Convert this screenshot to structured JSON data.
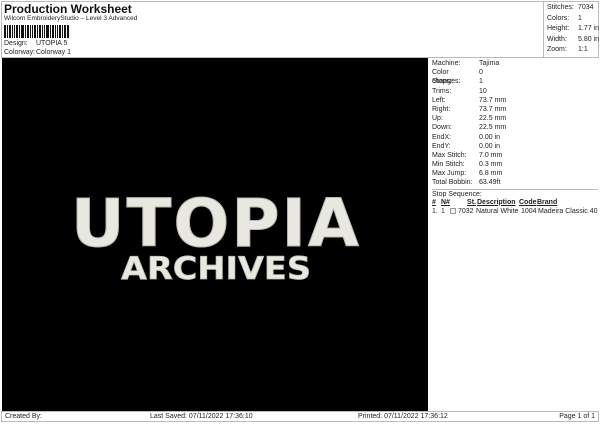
{
  "header": {
    "title": "Production Worksheet",
    "subtitle": "Wilcom EmbroideryStudio – Level 3 Advanced",
    "design_label": "Design:",
    "design_value": "UTOPIA 5",
    "colorway_label": "Colorway:",
    "colorway_value": "Colorway 1"
  },
  "stats": [
    {
      "label": "Stitches:",
      "value": "7034"
    },
    {
      "label": "Colors:",
      "value": "1"
    },
    {
      "label": "Height:",
      "value": "1.77 in"
    },
    {
      "label": "Width:",
      "value": "5.80 in"
    },
    {
      "label": "Zoom:",
      "value": "1:1"
    }
  ],
  "design": {
    "line1": "UTOPIA",
    "line2": "ARCHIVES",
    "thread_color": "#e8e8e0",
    "background": "#000000"
  },
  "info": [
    {
      "label": "Machine:",
      "value": "Tajima"
    },
    {
      "label": "Color changes:",
      "value": "0"
    },
    {
      "label": "Stops:",
      "value": "1"
    },
    {
      "label": "Trims:",
      "value": "10"
    },
    {
      "label": "Left:",
      "value": "73.7 mm"
    },
    {
      "label": "Right:",
      "value": "73.7 mm"
    },
    {
      "label": "Up:",
      "value": "22.5 mm"
    },
    {
      "label": "Down:",
      "value": "22.5 mm"
    },
    {
      "label": "EndX:",
      "value": "0.00 in"
    },
    {
      "label": "EndY:",
      "value": "0.00 in"
    },
    {
      "label": "Max Stitch:",
      "value": "7.0 mm"
    },
    {
      "label": "Min Stitch:",
      "value": "0.3 mm"
    },
    {
      "label": "Max Jump:",
      "value": "6.8 mm"
    },
    {
      "label": "Total Bobbin:",
      "value": "63.49ft"
    }
  ],
  "stop_sequence": {
    "title": "Stop Sequence:",
    "headers": [
      "#",
      "N#",
      "St.",
      "Description",
      "Code",
      "Brand"
    ],
    "rows": [
      {
        "num": "1.",
        "n": "1",
        "st": "7032",
        "description": "Natural White",
        "code": "1004",
        "brand": "Madeira Classic 40",
        "swatch": "#f3f3ef"
      }
    ]
  },
  "footer": {
    "created_by": "Created By:",
    "last_saved": "Last Saved: 07/11/2022 17:36:10",
    "printed": "Printed: 07/11/2022 17:36:12",
    "page": "Page 1 of 1"
  }
}
